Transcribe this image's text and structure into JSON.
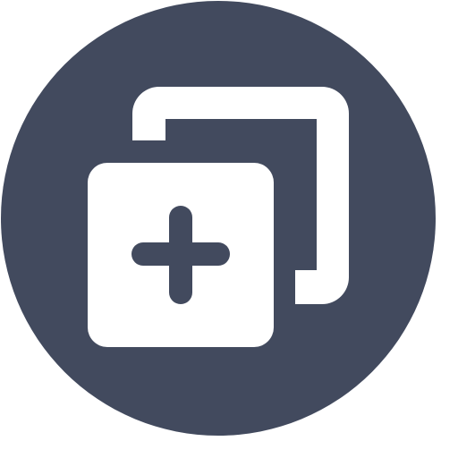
{
  "icon": {
    "name": "add-copy-icon",
    "background_color": "#424a5e",
    "foreground_color": "#ffffff"
  }
}
